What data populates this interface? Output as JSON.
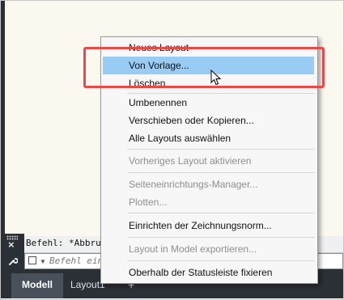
{
  "command_line": {
    "history_text": "Befehl: *Abbruch*",
    "input_placeholder": "Befehl eingeben"
  },
  "side_icons": {
    "close": "×",
    "customize": "wrench"
  },
  "tabs": [
    {
      "label": "Modell"
    },
    {
      "label": "Layout1"
    },
    {
      "label": "+"
    }
  ],
  "context_menu": {
    "items": [
      {
        "label": "Neues Layout",
        "enabled": true
      },
      {
        "label": "Von Vorlage...",
        "enabled": true,
        "highlighted": true
      },
      {
        "label": "Löschen",
        "enabled": true
      },
      {
        "label": "Umbenennen",
        "enabled": true
      },
      {
        "label": "Verschieben oder Kopieren...",
        "enabled": true
      },
      {
        "label": "Alle Layouts auswählen",
        "enabled": true
      },
      {
        "label": "Vorheriges Layout aktivieren",
        "enabled": false
      },
      {
        "label": "Seiteneinrichtungs-Manager...",
        "enabled": false
      },
      {
        "label": "Plotten...",
        "enabled": false
      },
      {
        "label": "Einrichten der Zeichnungsnorm...",
        "enabled": true
      },
      {
        "label": "Layout in Model exportieren...",
        "enabled": false
      },
      {
        "label": "Oberhalb der Statusleiste fixieren",
        "enabled": true
      }
    ]
  },
  "colors": {
    "highlight": "#99ccf5",
    "annotation_box": "#e94848",
    "canvas": "#fbf9ef",
    "panel": "#2b2f36"
  }
}
